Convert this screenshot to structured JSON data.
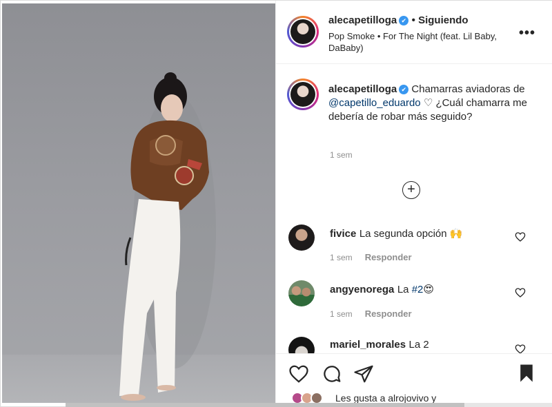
{
  "post": {
    "username": "alecapetilloga",
    "verified_mark": "✔",
    "follow_status": "• Siguiendo",
    "song": "Pop Smoke • For The Night (feat. Lil Baby, DaBaby)",
    "more_icon": "•••",
    "caption_user": "alecapetilloga",
    "caption_text_1": "Chamarras aviadoras de ",
    "caption_mention": "@capetillo_eduardo",
    "caption_text_2": " ♡ ¿Cuál chamarra me debería de robar más seguido?",
    "caption_time": "1 sem",
    "load_more_icon": "+"
  },
  "comments": [
    {
      "user": "fivice",
      "text": "La segunda opción 🙌",
      "time": "1 sem",
      "reply": "Responder"
    },
    {
      "user": "angyenorega",
      "text_prefix": "La ",
      "mention": "#2",
      "text_suffix": "😍",
      "time": "1 sem",
      "reply": "Responder"
    },
    {
      "user": "mariel_morales",
      "text": "La 2"
    }
  ],
  "likes": {
    "text": "Les gusta a alrojovivo y"
  },
  "colors": {
    "accent_blue": "#3897f0",
    "mention_blue": "#00376b",
    "muted_gray": "#8e8e8e",
    "text_dark": "#262626"
  },
  "icons": [
    "heart-icon",
    "comment-icon",
    "share-icon",
    "bookmark-icon",
    "more-options-icon",
    "add-circle-icon",
    "verified-badge-icon"
  ]
}
